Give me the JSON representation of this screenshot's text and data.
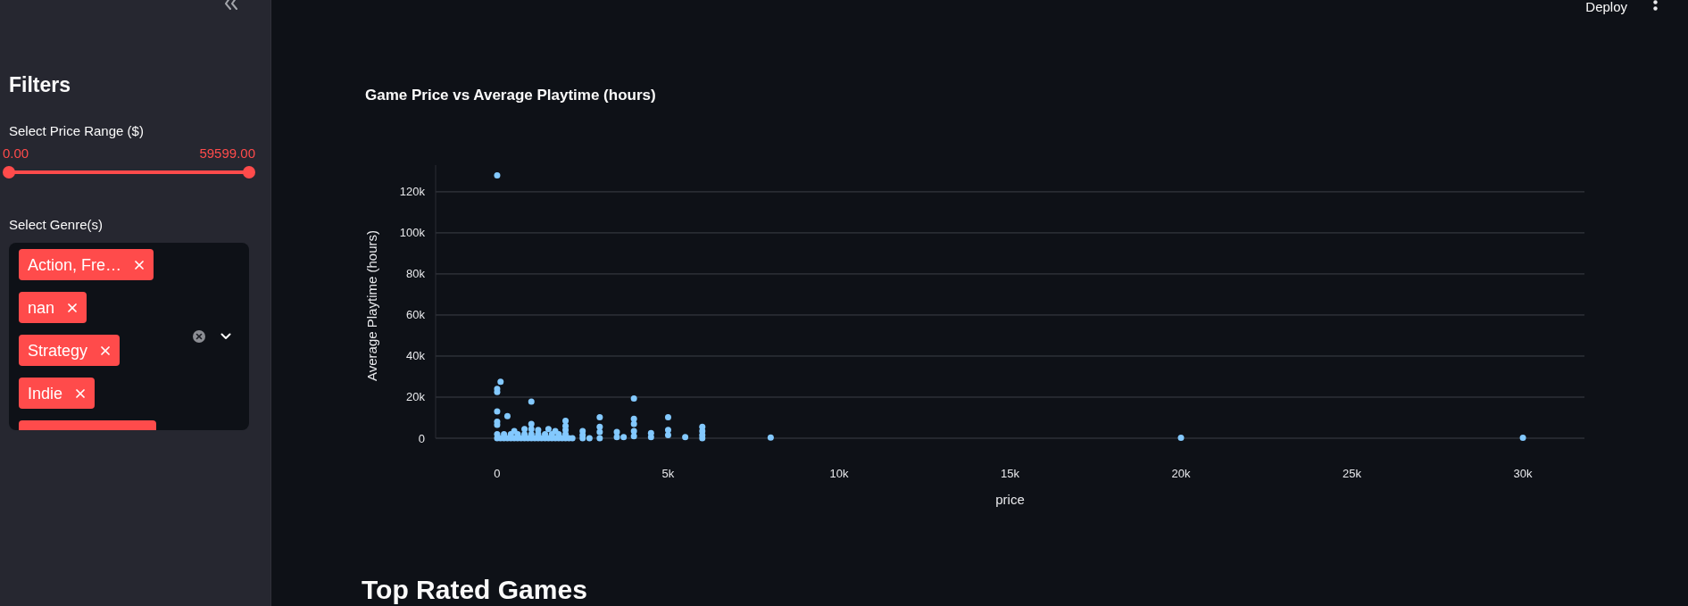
{
  "sidebar": {
    "title": "Filters",
    "price_slider": {
      "label": "Select Price Range ($)",
      "thumbs": [
        {
          "value": "0.00",
          "level": 0
        },
        {
          "value": "59599.00",
          "level": 1
        }
      ]
    },
    "genre_select": {
      "label": "Select Genre(s)",
      "tags": [
        {
          "label": "Action, Fre…",
          "clipped": false
        },
        {
          "label": "nan",
          "clipped": false
        },
        {
          "label": "Strategy",
          "clipped": false
        },
        {
          "label": "Indie",
          "clipped": false
        },
        {
          "clipped": true
        }
      ]
    }
  },
  "header": {
    "deploy_button": "Deploy"
  },
  "chart": {
    "chart_data": {
      "type": "scatter",
      "title": "Game Price vs Average Playtime (hours)",
      "xlabel": "price",
      "ylabel": "Average Playtime (hours)",
      "grid": true,
      "x": [
        0,
        0,
        0,
        100,
        0,
        300,
        0,
        0,
        1000,
        1000,
        1000,
        2000,
        2000,
        2000,
        500,
        800,
        1500,
        1200,
        1700,
        0,
        100,
        200,
        300,
        400,
        500,
        600,
        700,
        800,
        900,
        1000,
        1100,
        1200,
        1300,
        1400,
        1500,
        1600,
        1700,
        1800,
        1900,
        2000,
        2100,
        2200,
        0,
        200,
        400,
        600,
        800,
        1000,
        1200,
        1400,
        1600,
        1800,
        2000,
        2500,
        2500,
        2500,
        2700,
        3000,
        3000,
        3000,
        3000,
        3500,
        3500,
        3700,
        4000,
        4000,
        4000,
        4000,
        4000,
        4500,
        4500,
        5000,
        5000,
        5000,
        5500,
        6000,
        6000,
        6000,
        6000,
        8000,
        20000,
        30000
      ],
      "series": [
        {
          "color": "#83c9ff",
          "values": [
            128000,
            24000,
            22500,
            27500,
            13000,
            10800,
            8000,
            6500,
            17800,
            7000,
            4500,
            8500,
            6000,
            4000,
            3500,
            4500,
            4500,
            4000,
            3500,
            0,
            0,
            0,
            0,
            0,
            0,
            0,
            0,
            0,
            0,
            0,
            0,
            0,
            0,
            0,
            0,
            0,
            0,
            0,
            0,
            0,
            0,
            0,
            2000,
            2000,
            2000,
            2000,
            2000,
            2000,
            2000,
            2000,
            2000,
            2000,
            2000,
            0,
            1500,
            3500,
            0,
            0,
            3000,
            5500,
            10200,
            500,
            3000,
            500,
            1000,
            3500,
            7000,
            9500,
            19300,
            500,
            2500,
            1500,
            4000,
            10200,
            500,
            0,
            1500,
            3500,
            5500,
            300,
            200,
            200
          ]
        }
      ],
      "xlim": [
        -1800,
        31800
      ],
      "ylim": [
        0,
        133000
      ],
      "xticks": [
        {
          "value": 0,
          "label": "0"
        },
        {
          "value": 5000,
          "label": "5k"
        },
        {
          "value": 10000,
          "label": "10k"
        },
        {
          "value": 15000,
          "label": "15k"
        },
        {
          "value": 20000,
          "label": "20k"
        },
        {
          "value": 25000,
          "label": "25k"
        },
        {
          "value": 30000,
          "label": "30k"
        }
      ],
      "yticks": [
        {
          "value": 0,
          "label": "0"
        },
        {
          "value": 20000,
          "label": "20k"
        },
        {
          "value": 40000,
          "label": "40k"
        },
        {
          "value": 60000,
          "label": "60k"
        },
        {
          "value": 80000,
          "label": "80k"
        },
        {
          "value": 100000,
          "label": "100k"
        },
        {
          "value": 120000,
          "label": "120k"
        }
      ]
    }
  },
  "section_heading": "Top Rated Games"
}
